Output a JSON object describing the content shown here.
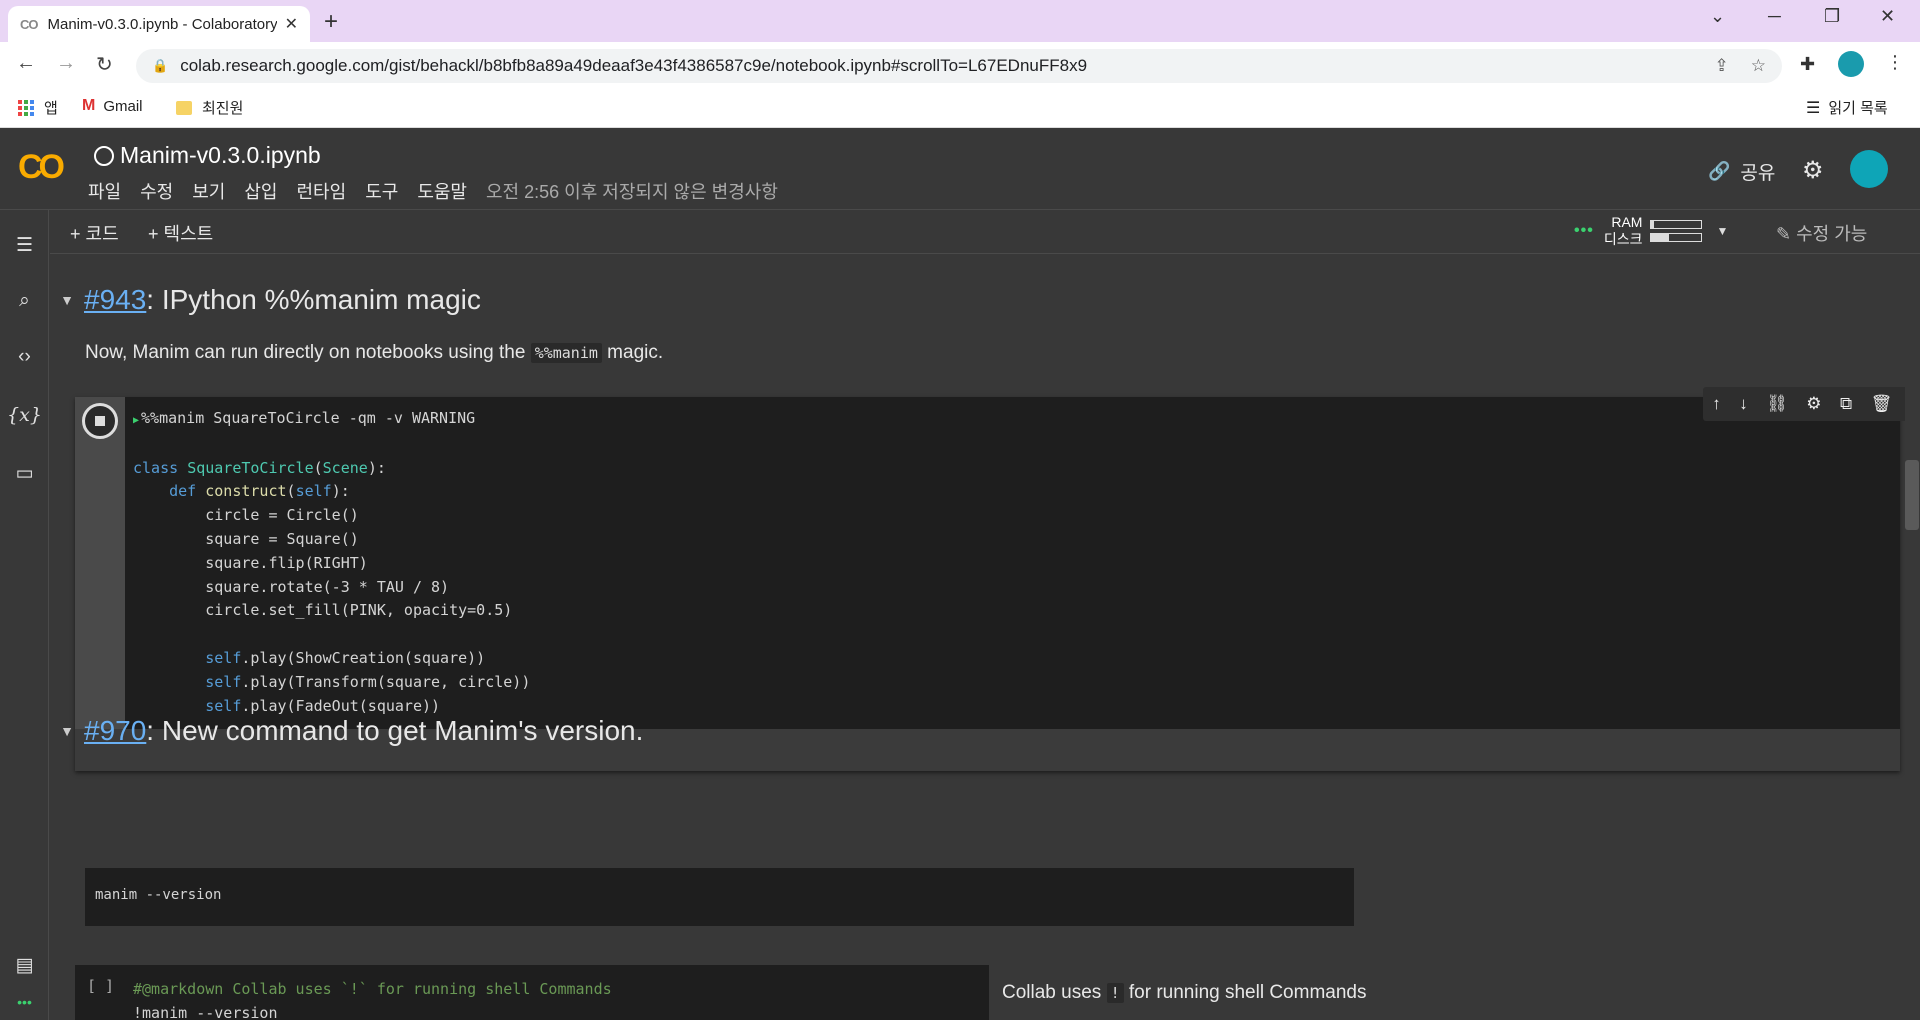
{
  "browser": {
    "tab_title": "Manim-v0.3.0.ipynb - Colaboratory",
    "url": "colab.research.google.com/gist/behackl/b8bfb8a89a49deaaf3e43f4386587c9e/notebook.ipynb#scrollTo=L67EDnuFF8x9",
    "bookmarks": [
      "앱",
      "Gmail",
      "최진원"
    ],
    "reading_list": "읽기 목록"
  },
  "colab": {
    "notebook_title": "Manim-v0.3.0.ipynb",
    "menu": [
      "파일",
      "수정",
      "보기",
      "삽입",
      "런타임",
      "도구",
      "도움말"
    ],
    "save_status": "오전 2:56 이후 저장되지 않은 변경사항",
    "share_label": "공유",
    "add_code": "+ 코드",
    "add_text": "+ 텍스트",
    "ram_label": "RAM",
    "disk_label": "디스크",
    "ram_usage": 0.05,
    "disk_usage": 0.35,
    "edit_mode": "수정 가능"
  },
  "sections": [
    {
      "link": "#943",
      "title": ": IPython %%manim magic",
      "text_before": "Now, Manim can run directly on notebooks using the ",
      "inline_code": "%%manim",
      "text_after": " magic."
    },
    {
      "link": "#970",
      "title": ": New command to get Manim's version.",
      "code": "manim --version"
    }
  ],
  "cell1": {
    "line1": "%%manim SquareToCircle -qm -v WARNING",
    "line_class_kw": "class",
    "line_class_name": "SquareToCircle",
    "line_class_base": "Scene",
    "line_def_kw": "def",
    "line_def_name": "construct",
    "line_def_self": "self",
    "lines": [
      "circle = Circle()",
      "square = Square()",
      "square.flip(RIGHT)",
      "square.rotate(-3 * TAU / 8)",
      "circle.set_fill(PINK, opacity=0.5)"
    ],
    "play_lines": [
      ".play(ShowCreation(square))",
      ".play(Transform(square, circle))",
      ".play(FadeOut(square))"
    ],
    "self_kw": "self"
  },
  "cell3": {
    "brackets": "[ ]",
    "comment_line": "#@markdown Collab uses `!` for running shell Commands",
    "cmd_line": "!manim --version",
    "form_before": "Collab uses ",
    "form_code": "!",
    "form_after": " for running shell Commands"
  }
}
